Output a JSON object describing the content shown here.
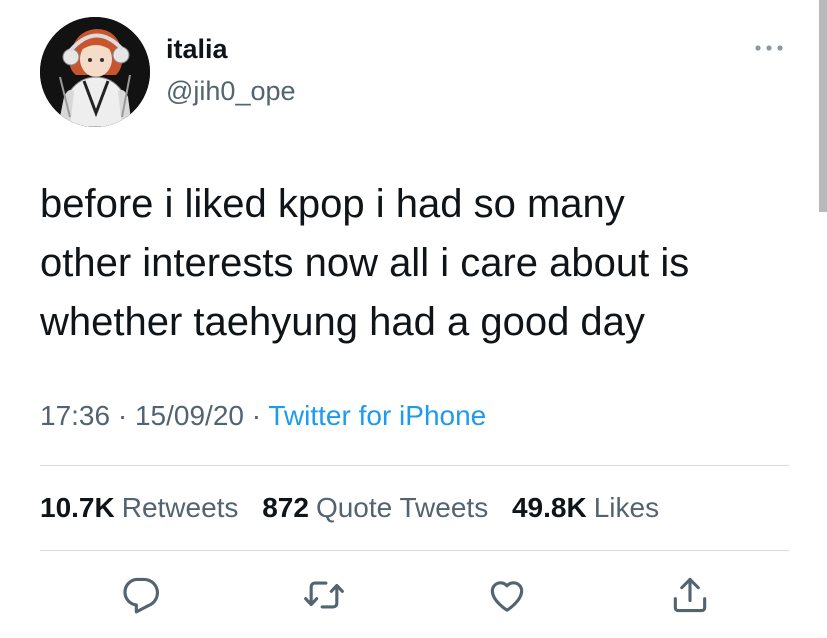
{
  "user": {
    "display_name": "italia",
    "handle": "@jih0_ope"
  },
  "tweet": {
    "text": "before i liked kpop i had so many\nother interests now all i care about is\nwhether taehyung had a good day",
    "time": "17:36",
    "separator": " · ",
    "date": "15/09/20",
    "source": "Twitter for iPhone"
  },
  "stats": {
    "retweets_count": "10.7K",
    "retweets_label": "Retweets",
    "quote_count": "872",
    "quote_label": "Quote Tweets",
    "likes_count": "49.8K",
    "likes_label": "Likes"
  },
  "icons": {
    "more": "more-dots-icon",
    "reply": "reply-bubble-icon",
    "retweet": "retweet-arrows-icon",
    "like": "heart-icon",
    "share": "share-upload-icon"
  },
  "colors": {
    "text": "#0f1419",
    "secondary": "#536471",
    "accent": "#1d9bf0",
    "divider": "#d9dde0"
  }
}
